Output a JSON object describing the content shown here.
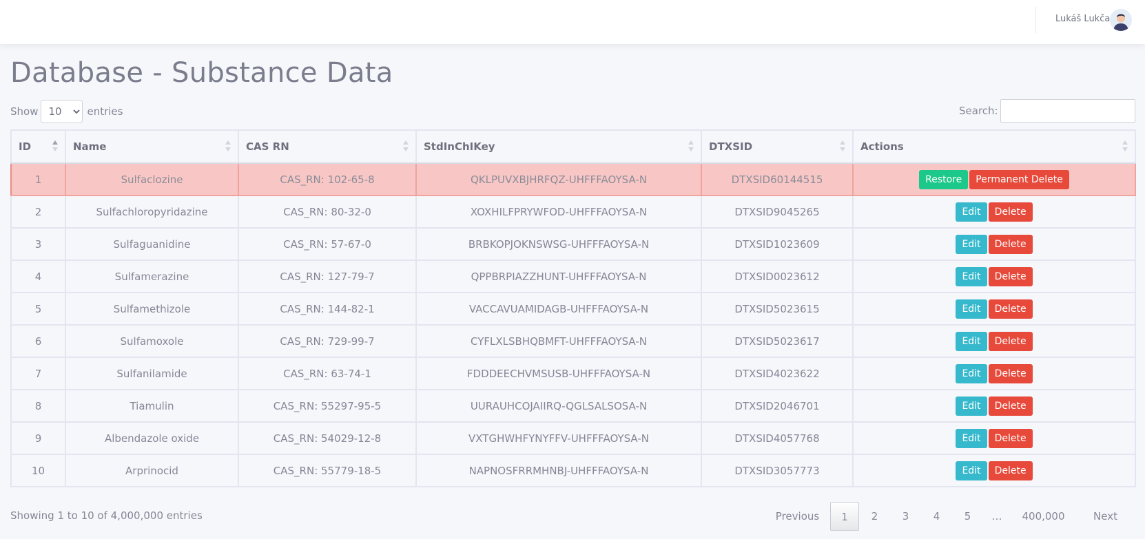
{
  "header": {
    "user_name": "Lukáš Lukča"
  },
  "page": {
    "title": "Database - Substance Data"
  },
  "controls": {
    "show_label": "Show",
    "entries_label": "entries",
    "length_value": "10",
    "search_label": "Search:",
    "search_value": ""
  },
  "table": {
    "columns": [
      "ID",
      "Name",
      "CAS RN",
      "StdInChIKey",
      "DTXSID",
      "Actions"
    ],
    "rows": [
      {
        "id": "1",
        "name": "Sulfaclozine",
        "cas": "CAS_RN: 102-65-8",
        "key": "QKLPUVXBJHRFQZ-UHFFFAOYSA-N",
        "dtxsid": "DTXSID60144515",
        "deleted": true
      },
      {
        "id": "2",
        "name": "Sulfachloropyridazine",
        "cas": "CAS_RN: 80-32-0",
        "key": "XOXHILFPRYWFOD-UHFFFAOYSA-N",
        "dtxsid": "DTXSID9045265",
        "deleted": false
      },
      {
        "id": "3",
        "name": "Sulfaguanidine",
        "cas": "CAS_RN: 57-67-0",
        "key": "BRBKOPJOKNSWSG-UHFFFAOYSA-N",
        "dtxsid": "DTXSID1023609",
        "deleted": false
      },
      {
        "id": "4",
        "name": "Sulfamerazine",
        "cas": "CAS_RN: 127-79-7",
        "key": "QPPBRPIAZZHUNT-UHFFFAOYSA-N",
        "dtxsid": "DTXSID0023612",
        "deleted": false
      },
      {
        "id": "5",
        "name": "Sulfamethizole",
        "cas": "CAS_RN: 144-82-1",
        "key": "VACCAVUAMIDAGB-UHFFFAOYSA-N",
        "dtxsid": "DTXSID5023615",
        "deleted": false
      },
      {
        "id": "6",
        "name": "Sulfamoxole",
        "cas": "CAS_RN: 729-99-7",
        "key": "CYFLXLSBHQBMFT-UHFFFAOYSA-N",
        "dtxsid": "DTXSID5023617",
        "deleted": false
      },
      {
        "id": "7",
        "name": "Sulfanilamide",
        "cas": "CAS_RN: 63-74-1",
        "key": "FDDDEECHVMSUSB-UHFFFAOYSA-N",
        "dtxsid": "DTXSID4023622",
        "deleted": false
      },
      {
        "id": "8",
        "name": "Tiamulin",
        "cas": "CAS_RN: 55297-95-5",
        "key": "UURAUHCOJAIIRQ-QGLSALSOSA-N",
        "dtxsid": "DTXSID2046701",
        "deleted": false
      },
      {
        "id": "9",
        "name": "Albendazole oxide",
        "cas": "CAS_RN: 54029-12-8",
        "key": "VXTGHWHFYNYFFV-UHFFFAOYSA-N",
        "dtxsid": "DTXSID4057768",
        "deleted": false
      },
      {
        "id": "10",
        "name": "Arprinocid",
        "cas": "CAS_RN: 55779-18-5",
        "key": "NAPNOSFRRMHNBJ-UHFFFAOYSA-N",
        "dtxsid": "DTXSID3057773",
        "deleted": false
      }
    ],
    "actions": {
      "restore": "Restore",
      "permanent_delete": "Permanent Delete",
      "edit": "Edit",
      "delete": "Delete"
    }
  },
  "footer": {
    "info": "Showing 1 to 10 of 4,000,000 entries",
    "pagination": {
      "previous": "Previous",
      "pages": [
        "1",
        "2",
        "3",
        "4",
        "5"
      ],
      "ellipsis": "…",
      "last": "400,000",
      "next": "Next",
      "current": "1"
    }
  },
  "colors": {
    "deleted_row": "#f8c7c5",
    "restore": "#1cc88a",
    "delete": "#e74a3b",
    "edit": "#36b9cc"
  }
}
